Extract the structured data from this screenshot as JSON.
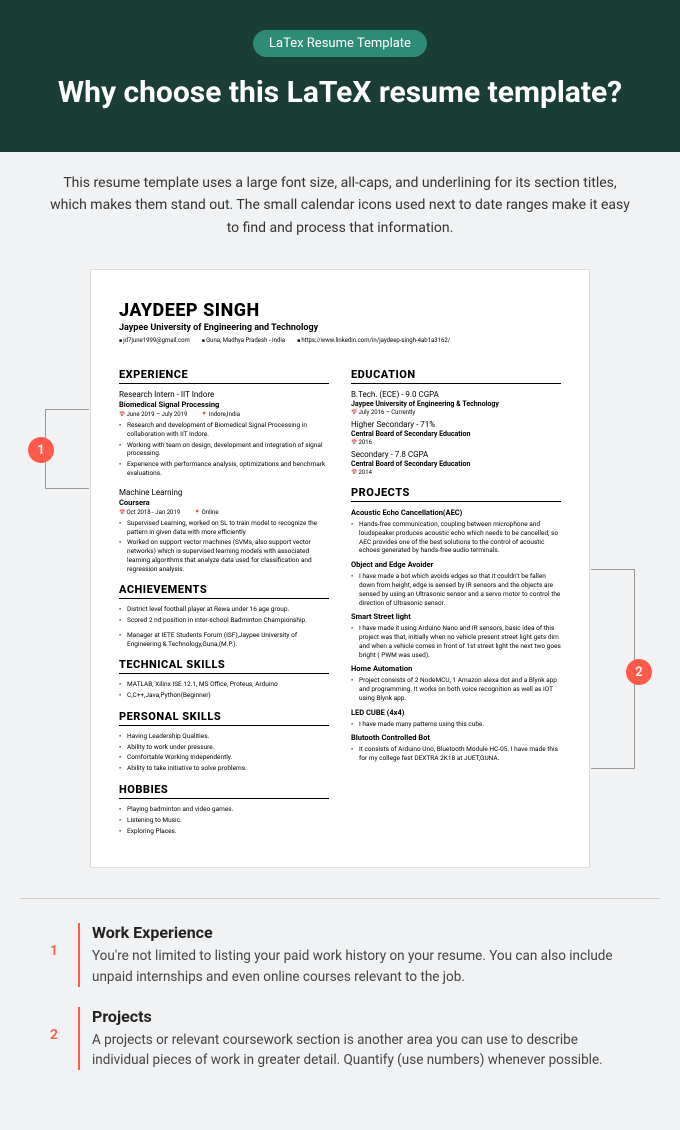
{
  "header": {
    "tag": "LaTex Resume Template",
    "title": "Why choose this LaTeX resume template?"
  },
  "intro": "This resume template uses a large font size, all-caps, and underlining for its section titles, which makes them stand out. The small calendar icons used next to date ranges make it easy to find and process that information.",
  "resume": {
    "name": "JAYDEEP SINGH",
    "university": "Jaypee University of Engineering and Technology",
    "contact": {
      "email": "jd7june1999@gmail.com",
      "location": "Guna, Madhya Pradesh - India",
      "linkedin": "https://www.linkedin.com/in/jaydeep-singh-4ab1a3162/"
    },
    "left": {
      "experience": {
        "h": "EXPERIENCE",
        "job1": {
          "title": "Research Intern - IIT Indore",
          "sub": "Biomedical Signal Processing",
          "date": "June 2019 – July 2019",
          "loc": "Indore,India",
          "b1": "Research and development of Biomedical Signal Processing in collaboration with IIT Indore.",
          "b2": "Working with team on design, development and integration of signal processing.",
          "b3": "Experience with performance analysis, optimizations and benchmark evaluations."
        },
        "job2": {
          "title": "Machine Learning",
          "sub": "Coursera",
          "date": "Oct 2018 - Jan 2019",
          "loc": "Online",
          "b1": "Supervised Learning, worked on SL to train model to recognize the pattern in given data with more efficiently",
          "b2": "Worked on support vector machines (SVMs, also support vector networks) which is supervised learning models with associated learning algorithms that analyze data used for classification and regression analysis."
        }
      },
      "achievements": {
        "h": "ACHIEVEMENTS",
        "b1": "District level football player at Rewa under 16 age group.",
        "b2": "Scored 2 nd position in inter-school Badminton Championship.",
        "b3": "Manager at IETE Students Forum (ISF),Jaypee University of Engineering & Technology,Guna,(M.P.)."
      },
      "technical": {
        "h": "TECHNICAL SKILLS",
        "b1": "MATLAB, Xilinx ISE 12.1, MS Office, Proteus, Arduino",
        "b2": "C,C++,Java,Python(Beginner)"
      },
      "personal": {
        "h": "PERSONAL SKILLS",
        "b1": "Having Leadership Qualities.",
        "b2": "Ability to work under pressure.",
        "b3": "Comfortable Working Independently.",
        "b4": "Ability to take initiative to solve problems."
      },
      "hobbies": {
        "h": "HOBBIES",
        "b1": "Playing badminton and video games.",
        "b2": "Listening to Music.",
        "b3": "Exploring Places."
      }
    },
    "right": {
      "education": {
        "h": "EDUCATION",
        "e1": {
          "t": "B.Tech. (ECE) - 9.0 CGPA",
          "s": "Jaypee University of Engineering & Technology",
          "d": "July 2016 – Currently"
        },
        "e2": {
          "t": "Higher Secondary - 71%",
          "s": "Central Board of Secondary Education",
          "d": "2016"
        },
        "e3": {
          "t": "Secondary - 7.8 CGPA",
          "s": "Central Board of Secondary Education",
          "d": "2014"
        }
      },
      "projects": {
        "h": "PROJECTS",
        "p1": {
          "t": "Acoustic Echo Cancellation(AEC)",
          "b": "Hands-free communication, coupling between microphone and loudspeaker produces acoustic echo which needs to be cancelled, so AEC provides one of the best solutions to the control of acoustic echoes generated by hands-free audio terminals."
        },
        "p2": {
          "t": "Object and Edge Avoider",
          "b": "I have made a bot which avoids edges so that it couldn't be fallen down from height, edge is sensed by IR sensors and the objects are sensed by using an Ultrasonic sensor and a servo motor to control the direction of Ultrasonic sensor."
        },
        "p3": {
          "t": "Smart Street light",
          "b": "I have made it using Arduino Nano and IR sensors, basic idea of this project was that, initially when no vehicle present street light gets dim and when a vehicle comes in front of 1st street light the next two goes bright ( PWM was used)."
        },
        "p4": {
          "t": "Home Automation",
          "b": "Project consists of 2 NodeMCU, 1 Amazon alexa dot and a Blynk app and programming. It works on both voice recognition as well as IOT using Blynk app."
        },
        "p5": {
          "t": "LED CUBE (4x4)",
          "b": "I have made many patterns using this cube."
        },
        "p6": {
          "t": "Blutooth Controlled Bot",
          "b": "It consists of Arduino Uno, Bluetooth Module HC-05. I have made this for my college fest DEXTRA 2K18 at JUET,GUNA."
        }
      }
    }
  },
  "markers": {
    "m1": "1",
    "m2": "2"
  },
  "notes": {
    "n1": {
      "num": "1",
      "h": "Work Experience",
      "p": "You're not limited to listing your paid work history on your resume. You can also include unpaid internships and even online courses relevant to the job."
    },
    "n2": {
      "num": "2",
      "h": "Projects",
      "p": "A projects or relevant coursework section is another area you can use to describe individual pieces of work in greater detail. Quantify (use numbers) whenever possible."
    }
  }
}
